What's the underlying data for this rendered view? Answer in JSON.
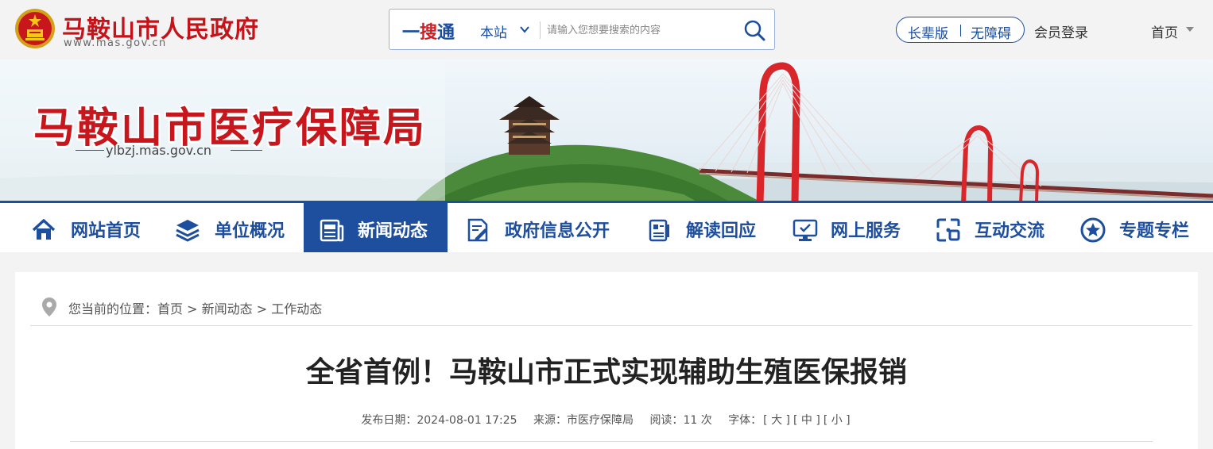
{
  "header": {
    "site_name": "马鞍山市人民政府",
    "site_domain": "www.mas.gov.cn",
    "search": {
      "brand_part1": "一",
      "brand_part2": "搜",
      "brand_part3": "通",
      "scope": "本站",
      "placeholder": "请输入您想要搜索的内容"
    },
    "elder_mode": "长辈版",
    "accessibility": "无障碍",
    "login": "会员登录",
    "home": "首页"
  },
  "banner": {
    "title": "马鞍山市医疗保障局",
    "domain": "ylbzj.mas.gov.cn"
  },
  "nav": {
    "items": [
      {
        "label": "网站首页",
        "icon": "home-icon"
      },
      {
        "label": "单位概况",
        "icon": "layers-icon"
      },
      {
        "label": "新闻动态",
        "icon": "newspaper-icon",
        "active": true
      },
      {
        "label": "政府信息公开",
        "icon": "document-edit-icon"
      },
      {
        "label": "解读回应",
        "icon": "clipboard-icon"
      },
      {
        "label": "网上服务",
        "icon": "monitor-icon"
      },
      {
        "label": "互动交流",
        "icon": "interact-icon"
      },
      {
        "label": "专题专栏",
        "icon": "star-icon"
      }
    ]
  },
  "breadcrumb": {
    "prefix": "您当前的位置：",
    "items": [
      "首页",
      "新闻动态",
      "工作动态"
    ],
    "sep": " > "
  },
  "article": {
    "title": "全省首例！马鞍山市正式实现辅助生殖医保报销",
    "publish_label": "发布日期：",
    "publish_date": "2024-08-01 17:25",
    "source_label": "来源：",
    "source": "市医疗保障局",
    "reads_label": "阅读：",
    "reads": "11 次",
    "font_label": "字体：",
    "font_large": "[ 大 ]",
    "font_medium": "[ 中 ]",
    "font_small": "[ 小 ]"
  },
  "colors": {
    "brand_red": "#c4141a",
    "nav_blue": "#1e4f9f"
  }
}
